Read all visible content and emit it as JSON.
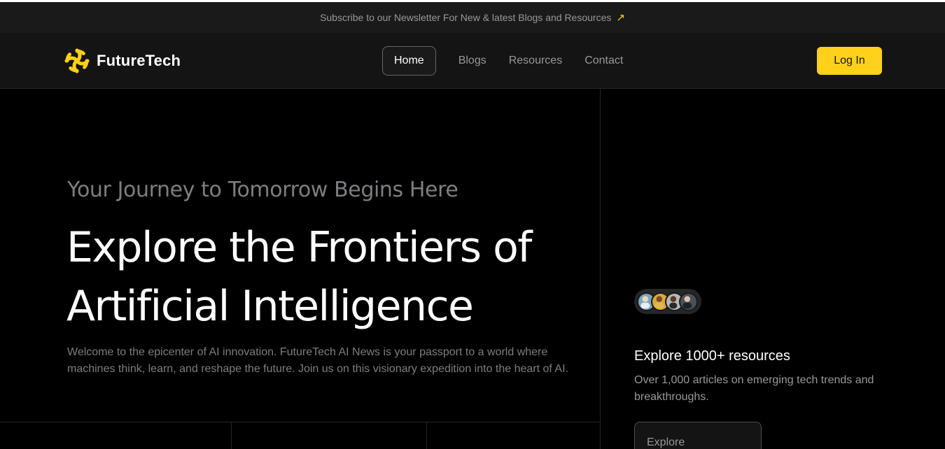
{
  "newsletter": {
    "text": "Subscribe to our Newsletter For New & latest Blogs and Resources",
    "icon": "arrow-up-right-icon"
  },
  "brand": {
    "name": "FutureTech",
    "accent_color": "#ffd11a"
  },
  "nav": {
    "items": [
      {
        "label": "Home",
        "active": true
      },
      {
        "label": "Blogs",
        "active": false
      },
      {
        "label": "Resources",
        "active": false
      },
      {
        "label": "Contact",
        "active": false
      }
    ],
    "login_label": "Log In"
  },
  "hero": {
    "eyebrow": "Your Journey to Tomorrow Begins Here",
    "headline_line1": "Explore the Frontiers of",
    "headline_line2": "Artificial Intelligence",
    "intro": "Welcome to the epicenter of AI innovation. FutureTech AI News is your passport to a world where machines think, learn, and reshape the future. Join us on this visionary expedition into the heart of AI."
  },
  "resources": {
    "title": "Explore 1000+ resources",
    "description": "Over 1,000 articles on emerging tech trends and breakthroughs.",
    "button_label": "Explore Resources"
  }
}
